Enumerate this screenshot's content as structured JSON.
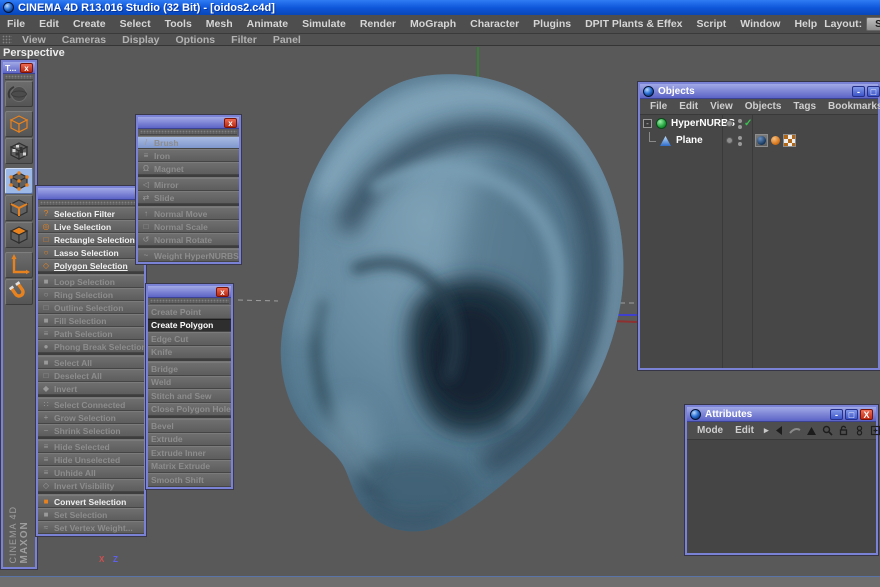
{
  "window": {
    "title": "CINEMA 4D R13.016 Studio (32 Bit) - [oidos2.c4d]"
  },
  "main_menu": {
    "items": [
      "File",
      "Edit",
      "Create",
      "Select",
      "Tools",
      "Mesh",
      "Animate",
      "Simulate",
      "Render",
      "MoGraph",
      "Character",
      "Plugins",
      "DPIT Plants & Effex",
      "Script",
      "Window",
      "Help"
    ],
    "layout_label": "Layout:",
    "layout_value": "Stand"
  },
  "viewport_menu": {
    "items": [
      "View",
      "Cameras",
      "Display",
      "Options",
      "Filter",
      "Panel"
    ]
  },
  "viewport": {
    "label": "Perspective",
    "axis_x_label": "X",
    "axis_z_label": "Z"
  },
  "tools_palette": {
    "title": "T...",
    "close_label": "x",
    "buttons": [
      {
        "icon": "make-editable-icon",
        "enabled": false,
        "active": false,
        "gap_before": false
      },
      {
        "icon": "model-mode-icon",
        "enabled": true,
        "active": false,
        "gap_before": true
      },
      {
        "icon": "texture-mode-icon",
        "enabled": true,
        "active": false,
        "gap_before": false
      },
      {
        "icon": "point-mode-icon",
        "enabled": true,
        "active": true,
        "gap_before": true
      },
      {
        "icon": "edge-mode-icon",
        "enabled": true,
        "active": false,
        "gap_before": false
      },
      {
        "icon": "polygon-mode-icon",
        "enabled": true,
        "active": false,
        "gap_before": false
      },
      {
        "icon": "axis-mode-icon",
        "enabled": true,
        "active": false,
        "gap_before": true
      },
      {
        "icon": "snap-magnet-icon",
        "enabled": true,
        "active": false,
        "gap_before": false
      }
    ],
    "brand": {
      "line1": "MAXON",
      "line2": "CINEMA 4D"
    }
  },
  "selection_palette": {
    "items": [
      {
        "label": "Selection Filter",
        "enabled": true,
        "icon": "selection-filter-icon",
        "icon_color": "orange"
      },
      {
        "label": "Live Selection",
        "enabled": true,
        "icon": "live-selection-icon",
        "icon_color": "orange"
      },
      {
        "label": "Rectangle Selection",
        "enabled": true,
        "icon": "rectangle-selection-icon",
        "icon_color": "orange"
      },
      {
        "label": "Lasso Selection",
        "enabled": true,
        "icon": "lasso-selection-icon",
        "icon_color": "orange"
      },
      {
        "label": "Polygon Selection",
        "enabled": true,
        "active": true,
        "icon": "polygon-selection-icon",
        "icon_color": "orange"
      },
      {
        "label": "Loop Selection",
        "enabled": false,
        "separator_before": true,
        "icon": "loop-selection-icon"
      },
      {
        "label": "Ring Selection",
        "enabled": false,
        "icon": "ring-selection-icon"
      },
      {
        "label": "Outline Selection",
        "enabled": false,
        "icon": "outline-selection-icon"
      },
      {
        "label": "Fill Selection",
        "enabled": false,
        "icon": "fill-selection-icon"
      },
      {
        "label": "Path Selection",
        "enabled": false,
        "icon": "path-selection-icon"
      },
      {
        "label": "Phong Break Selection",
        "enabled": false,
        "icon": "phong-break-selection-icon"
      },
      {
        "label": "Select All",
        "enabled": false,
        "separator_before": true,
        "icon": "select-all-icon"
      },
      {
        "label": "Deselect All",
        "enabled": false,
        "icon": "deselect-all-icon"
      },
      {
        "label": "Invert",
        "enabled": false,
        "icon": "invert-icon"
      },
      {
        "label": "Select Connected",
        "enabled": false,
        "separator_before": true,
        "icon": "select-connected-icon"
      },
      {
        "label": "Grow Selection",
        "enabled": false,
        "icon": "grow-selection-icon"
      },
      {
        "label": "Shrink Selection",
        "enabled": false,
        "icon": "shrink-selection-icon"
      },
      {
        "label": "Hide Selected",
        "enabled": false,
        "separator_before": true,
        "icon": "hide-selected-icon"
      },
      {
        "label": "Hide Unselected",
        "enabled": false,
        "icon": "hide-unselected-icon"
      },
      {
        "label": "Unhide All",
        "enabled": false,
        "icon": "unhide-all-icon"
      },
      {
        "label": "Invert Visibility",
        "enabled": false,
        "icon": "invert-visibility-icon"
      },
      {
        "label": "Convert Selection",
        "enabled": true,
        "separator_before": true,
        "icon": "convert-selection-icon",
        "icon_color": "orange"
      },
      {
        "label": "Set Selection",
        "enabled": false,
        "icon": "set-selection-icon"
      },
      {
        "label": "Set Vertex Weight...",
        "enabled": false,
        "icon": "set-vertex-weight-icon"
      }
    ]
  },
  "brush_palette": {
    "close_label": "x",
    "items": [
      {
        "label": "Brush",
        "enabled": false,
        "highlight": true,
        "icon": "brush-icon"
      },
      {
        "label": "Iron",
        "enabled": false,
        "icon": "iron-icon"
      },
      {
        "label": "Magnet",
        "enabled": false,
        "icon": "magnet-tool-icon"
      },
      {
        "label": "Mirror",
        "enabled": false,
        "separator_before": true,
        "icon": "mirror-icon"
      },
      {
        "label": "Slide",
        "enabled": false,
        "icon": "slide-icon"
      },
      {
        "label": "Normal Move",
        "enabled": false,
        "separator_before": true,
        "icon": "normal-move-icon"
      },
      {
        "label": "Normal Scale",
        "enabled": false,
        "icon": "normal-scale-icon"
      },
      {
        "label": "Normal Rotate",
        "enabled": false,
        "icon": "normal-rotate-icon"
      },
      {
        "label": "Weight HyperNURBS",
        "enabled": false,
        "separator_before": true,
        "icon": "weight-hypernurbs-icon"
      }
    ]
  },
  "structure_palette": {
    "close_label": "x",
    "items": [
      {
        "label": "Create Point",
        "enabled": false
      },
      {
        "label": "Create Polygon",
        "enabled": true,
        "active_dark": true
      },
      {
        "label": "Edge Cut",
        "enabled": false
      },
      {
        "label": "Knife",
        "enabled": false
      },
      {
        "label": "Bridge",
        "enabled": false,
        "separator_before": true
      },
      {
        "label": "Weld",
        "enabled": false
      },
      {
        "label": "Stitch and Sew",
        "enabled": false
      },
      {
        "label": "Close Polygon Hole",
        "enabled": false
      },
      {
        "label": "Bevel",
        "enabled": false,
        "separator_before": true
      },
      {
        "label": "Extrude",
        "enabled": false
      },
      {
        "label": "Extrude Inner",
        "enabled": false
      },
      {
        "label": "Matrix Extrude",
        "enabled": false
      },
      {
        "label": "Smooth Shift",
        "enabled": false
      }
    ]
  },
  "objects_window": {
    "title": "Objects",
    "minimize_label": "-",
    "maximize_label": "□",
    "menu_items": [
      "File",
      "Edit",
      "View",
      "Objects",
      "Tags",
      "Bookmarks"
    ],
    "tree": [
      {
        "label": "HyperNURBS",
        "icon": "hypernurbs-icon",
        "expand": "-",
        "state_check": "✓"
      },
      {
        "label": "Plane",
        "icon": "plane-icon",
        "tags": [
          "selection-tag-icon",
          "phong-tag-icon",
          "uvw-tag-icon"
        ]
      }
    ]
  },
  "attributes_window": {
    "title": "Attributes",
    "minimize_label": "-",
    "maximize_label": "□",
    "close_label": "X",
    "menu_items": [
      "Mode",
      "Edit"
    ],
    "submenu_arrow": "▸"
  },
  "colors": {
    "titlebar_blue": "#0d55d8",
    "palette_border": "#7a82d6",
    "selection_highlight": "#8fa6d6",
    "active_tool_bg": "#9db9e8",
    "orange_accent": "#e8821e",
    "ear_base": "#61839a",
    "viewport_bg": "#595959"
  }
}
